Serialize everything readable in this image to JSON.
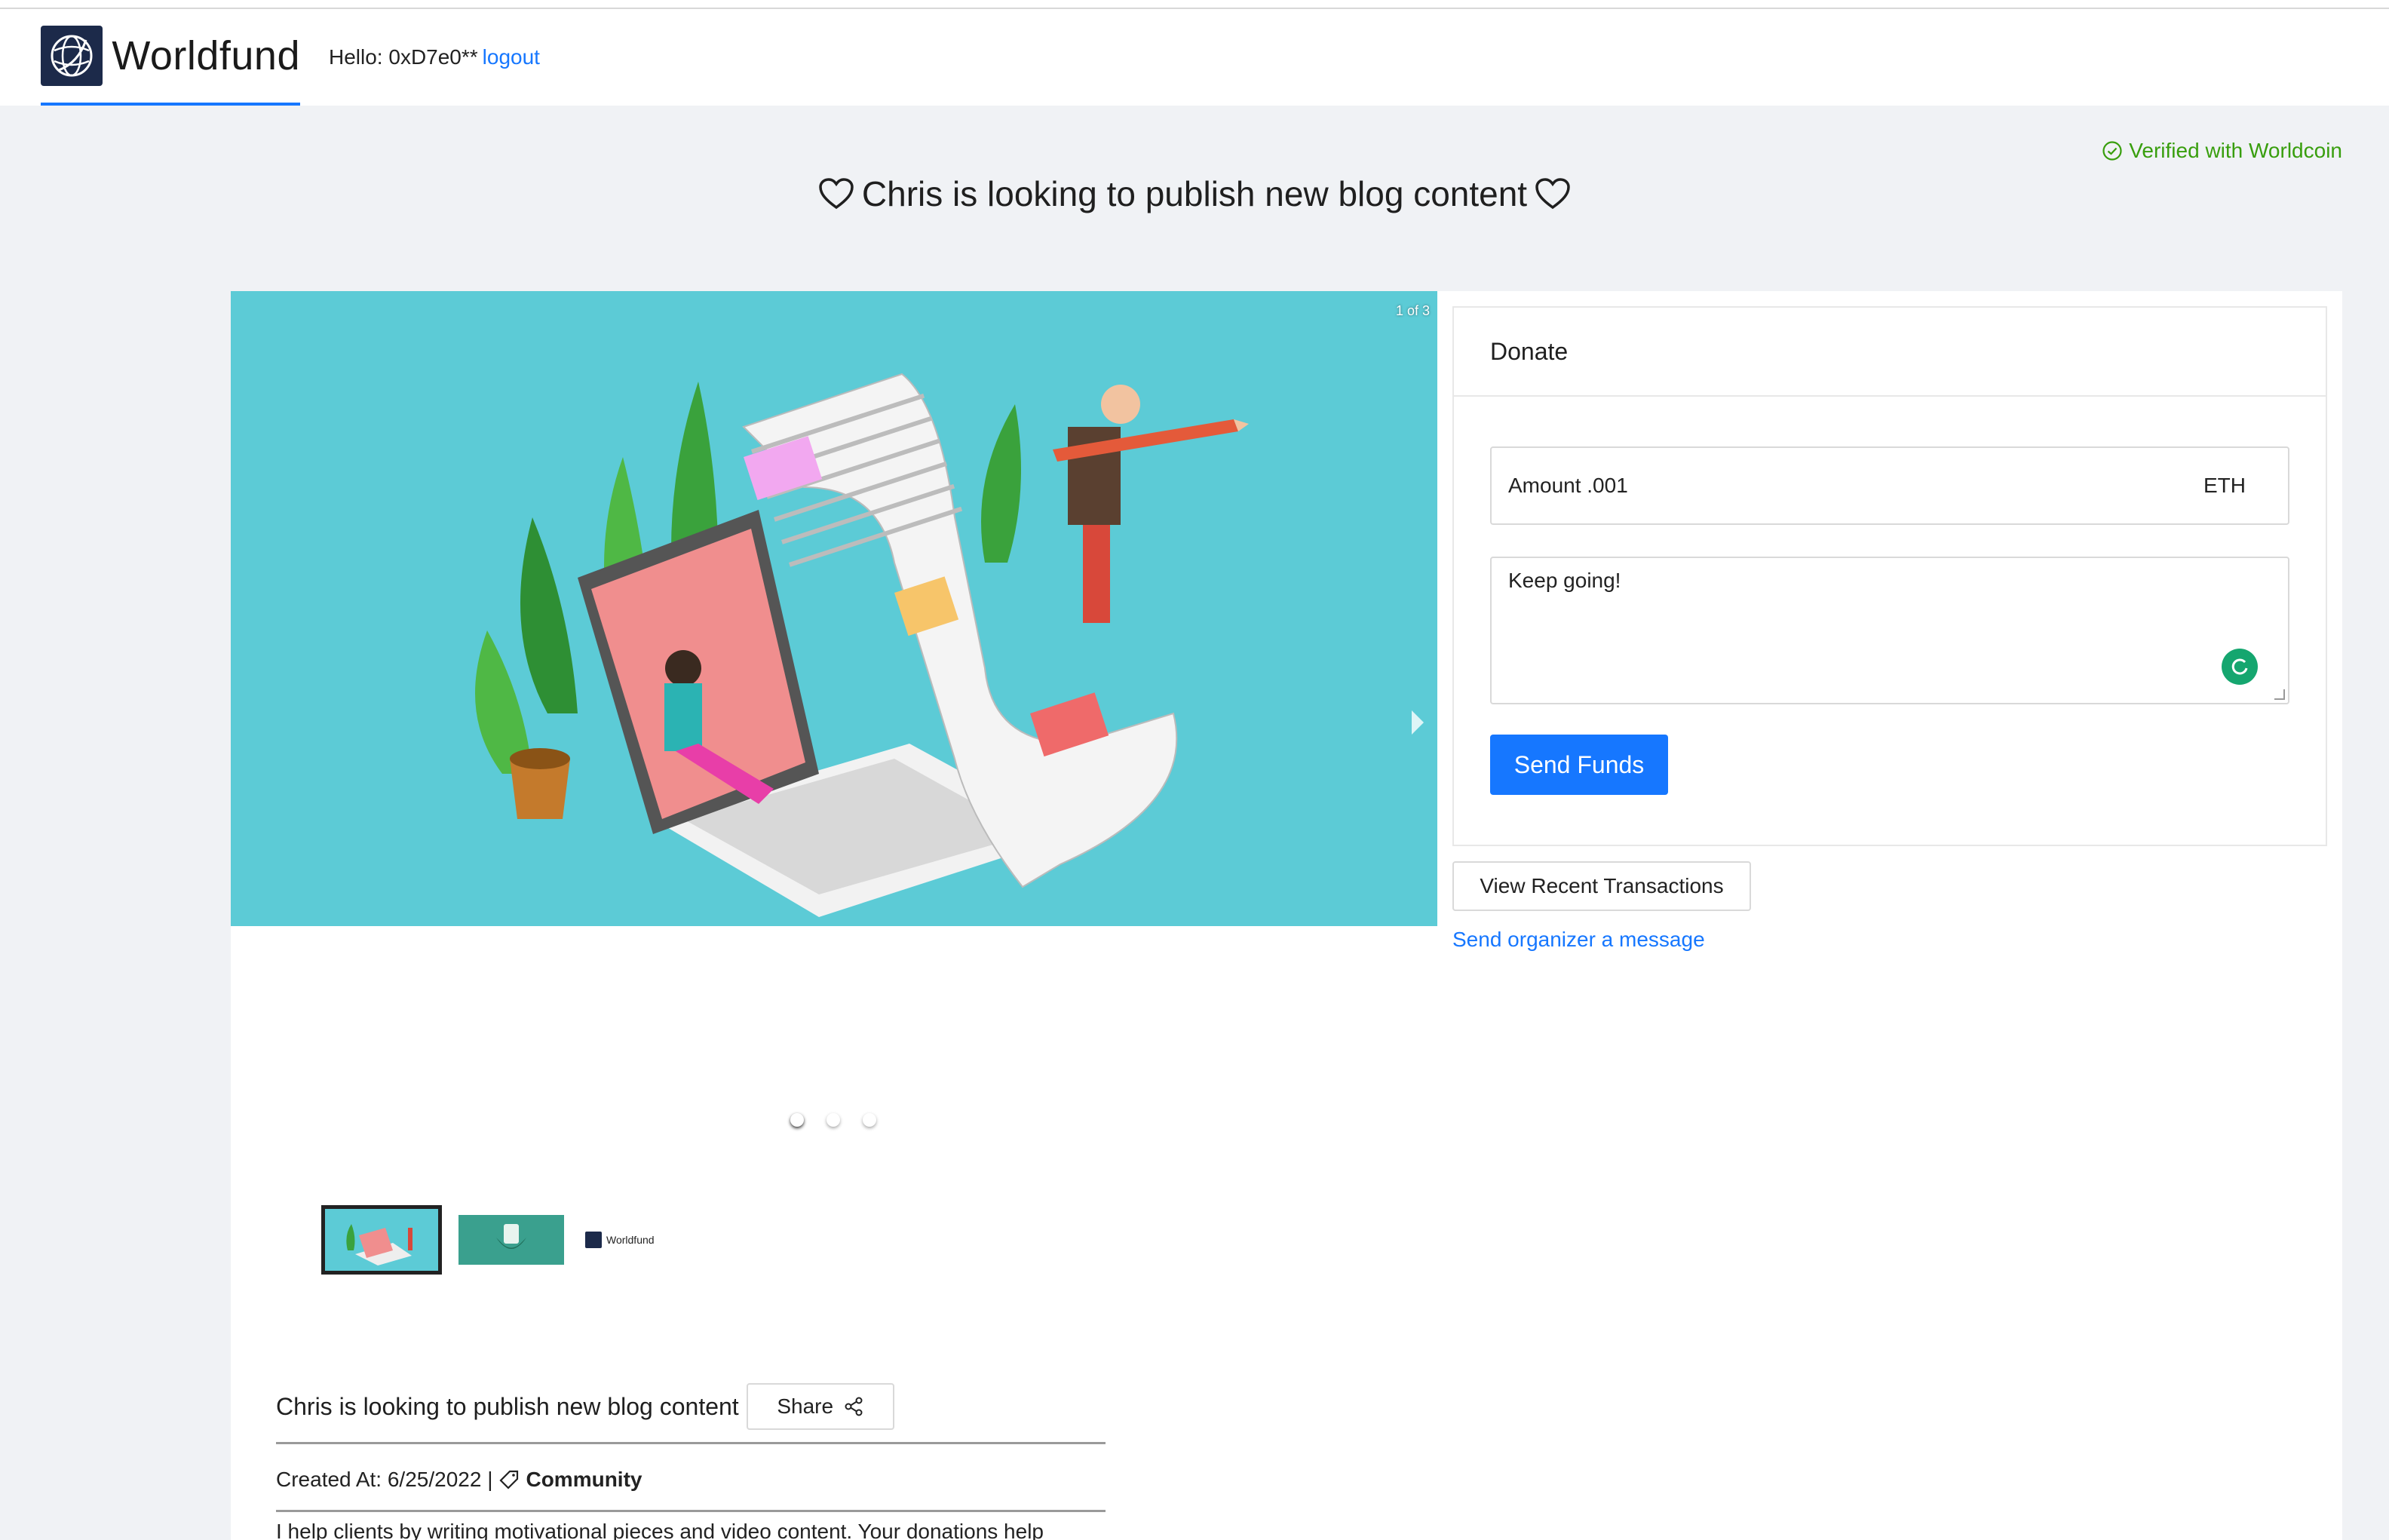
{
  "header": {
    "brand": "Worldfund",
    "hello": "Hello: 0xD7e0**",
    "logout": "logout"
  },
  "verified": "Verified with Worldcoin",
  "page_title": "Chris is looking to publish new blog content",
  "carousel": {
    "slide_count": "1 of 3",
    "thumb_brand": "Worldfund"
  },
  "detail": {
    "title": "Chris is looking to publish new blog content",
    "share": "Share",
    "created": "Created At: 6/25/2022 |",
    "category": "Community",
    "description": "I help clients by writing motivational pieces and video content. Your donations help"
  },
  "donate": {
    "heading": "Donate",
    "amount_text": "Amount .001",
    "currency": "ETH",
    "message": "Keep going!",
    "send": "Send Funds",
    "transactions": "View Recent Transactions",
    "message_link": "Send organizer a message"
  },
  "colors": {
    "accent": "#1677ff",
    "verified": "#389e0d",
    "slide_bg": "#5ccbd6"
  }
}
